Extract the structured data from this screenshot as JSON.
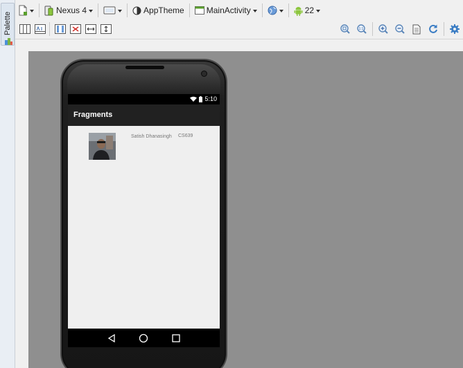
{
  "palette": {
    "label": "Palette"
  },
  "toolbar": {
    "device_label": "Nexus 4",
    "theme_label": "AppTheme",
    "activity_label": "MainActivity",
    "api_label": "22"
  },
  "phone": {
    "status_time": "5:10",
    "action_bar_title": "Fragments"
  },
  "list_item": {
    "name": "Satish Dhanasingh",
    "code": "CS639"
  },
  "colors": {
    "canvas_bg": "#8f8f8f",
    "action_bar": "#212121",
    "screen_bg": "#efefef",
    "android_green": "#8dc63f"
  }
}
